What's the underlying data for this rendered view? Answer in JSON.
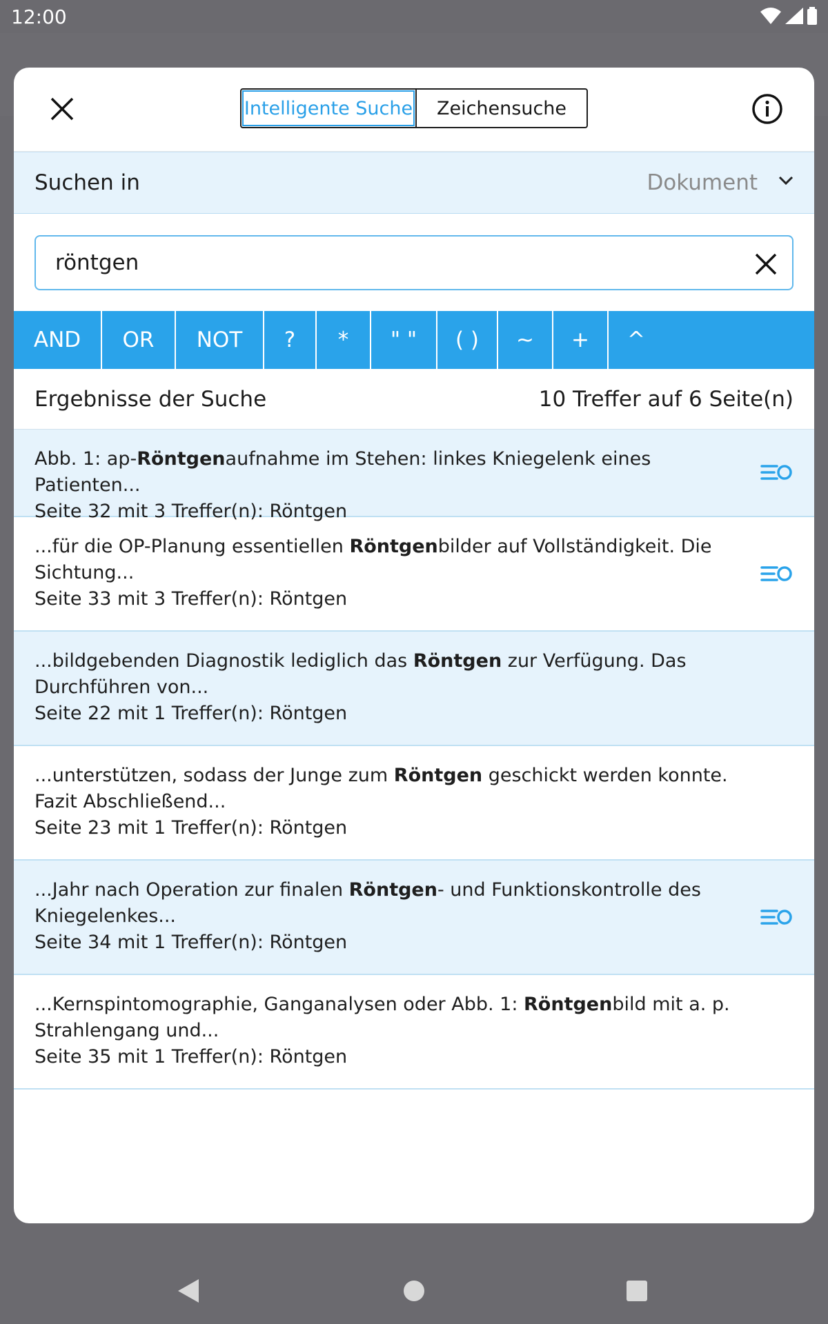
{
  "status": {
    "time": "12:00"
  },
  "modal": {
    "tabs": [
      {
        "label": "Intelligente Suche",
        "active": true
      },
      {
        "label": "Zeichensuche",
        "active": false
      }
    ],
    "search_in": {
      "label": "Suchen in",
      "value": "Dokument"
    },
    "query": "röntgen",
    "operators": [
      "AND",
      "OR",
      "NOT",
      "?",
      "*",
      "\" \"",
      "( )",
      "~",
      "+",
      "^"
    ],
    "results_title": "Ergebnisse der Suche",
    "results_count": "10 Treffer auf 6 Seite(n)",
    "results": [
      {
        "pre": "Abb. 1: ap-",
        "hit": "Röntgen",
        "post": "aufnahme im Stehen: linkes Kniegelenk eines Patienten...",
        "meta": "Seite 32 mit 3 Treffer(n): Röntgen",
        "has_filter_icon": true
      },
      {
        "pre": "...für die OP-Planung essentiellen ",
        "hit": "Röntgen",
        "post": "bilder auf Vollständigkeit. Die Sichtung...",
        "meta": "Seite 33 mit 3 Treffer(n): Röntgen",
        "has_filter_icon": true
      },
      {
        "pre": "...bildgebenden Diagnostik lediglich das ",
        "hit": "Röntgen",
        "post": " zur Verfügung. Das Durchführen von...",
        "meta": "Seite 22 mit 1 Treffer(n): Röntgen",
        "has_filter_icon": false
      },
      {
        "pre": "...unterstützen, sodass der Junge zum ",
        "hit": "Röntgen",
        "post": " geschickt werden konnte. Fazit Abschließend...",
        "meta": "Seite 23 mit 1 Treffer(n): Röntgen",
        "has_filter_icon": false
      },
      {
        "pre": "...Jahr nach Operation zur finalen ",
        "hit": "Röntgen",
        "post": "- und Funktionskontrolle des Kniegelenkes...",
        "meta": "Seite 34 mit 1 Treffer(n): Röntgen",
        "has_filter_icon": true
      },
      {
        "pre": "...Kernspintomographie, Ganganalysen oder Abb. 1: ",
        "hit": "Röntgen",
        "post": "bild mit a. p. Strahlengang und...",
        "meta": "Seite 35 mit 1 Treffer(n): Röntgen",
        "has_filter_icon": false
      }
    ]
  },
  "icons": {
    "close": "close-icon",
    "info": "info-icon",
    "chevron": "chevron-down-icon",
    "clear": "clear-icon",
    "filter": "filter-icon"
  },
  "colors": {
    "accent": "#2aa3ea",
    "row_alt": "#e6f3fc"
  }
}
